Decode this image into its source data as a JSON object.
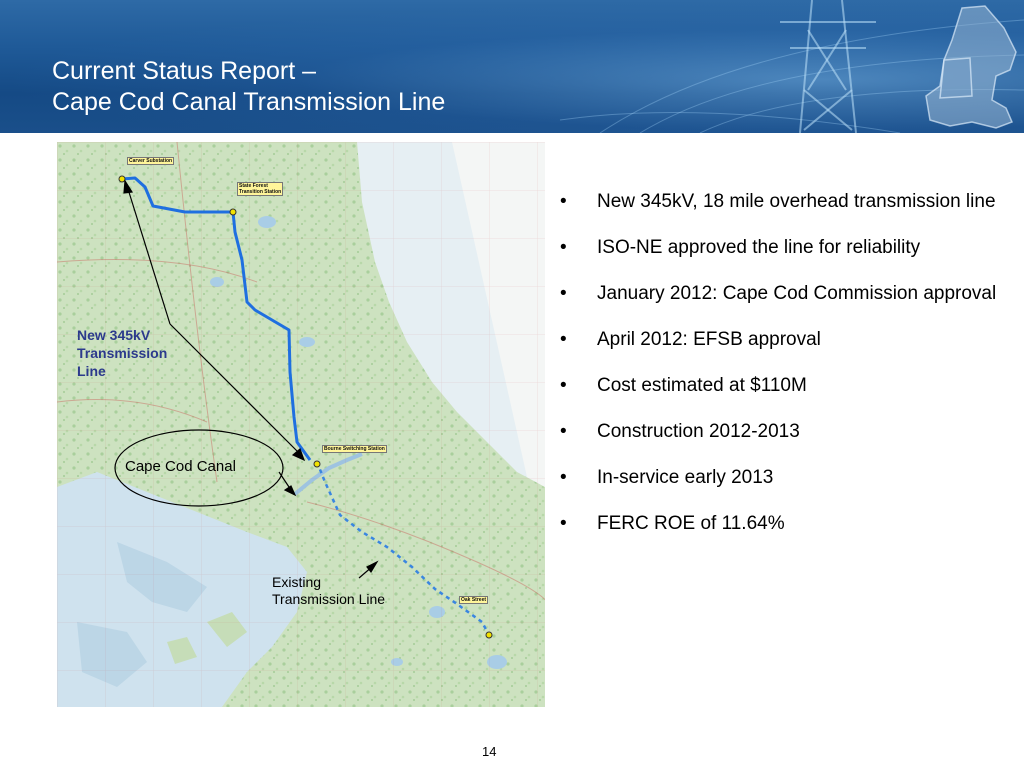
{
  "header": {
    "title_line1": "Current Status Report –",
    "title_line2": "Cape Cod Canal Transmission Line"
  },
  "map": {
    "labels": {
      "new_line": [
        "New 345kV",
        "Transmission",
        "Line"
      ],
      "canal": "Cape Cod Canal",
      "existing": [
        "Existing",
        "Transmission Line"
      ]
    },
    "stations": {
      "carver": "Carver Substation",
      "state_forest": [
        "State Forest",
        "Transition Station"
      ],
      "bourne": "Bourne Switching Station",
      "oak": "Oak Street"
    }
  },
  "bullets": [
    {
      "marker": "•",
      "text": "New 345kV, 18 mile overhead transmission line"
    },
    {
      "marker": "•",
      "text": "ISO-NE approved the line for reliability"
    },
    {
      "marker": "•",
      "text": "January 2012: Cape Cod Commission approval"
    },
    {
      "marker": "•",
      "text": "April 2012:  EFSB approval"
    },
    {
      "marker": "•",
      "text": "Cost estimated at $110M"
    },
    {
      "marker": "•",
      "text": "Construction 2012-2013"
    },
    {
      "marker": "•",
      "text": "In-service early 2013"
    },
    {
      "marker": "•",
      "text": "FERC ROE of 11.64%"
    }
  ],
  "page_number": "14",
  "colors": {
    "header_blue": "#1f5a98",
    "new_line_label": "#2c3a8c",
    "route_blue": "#1f6fe0"
  }
}
